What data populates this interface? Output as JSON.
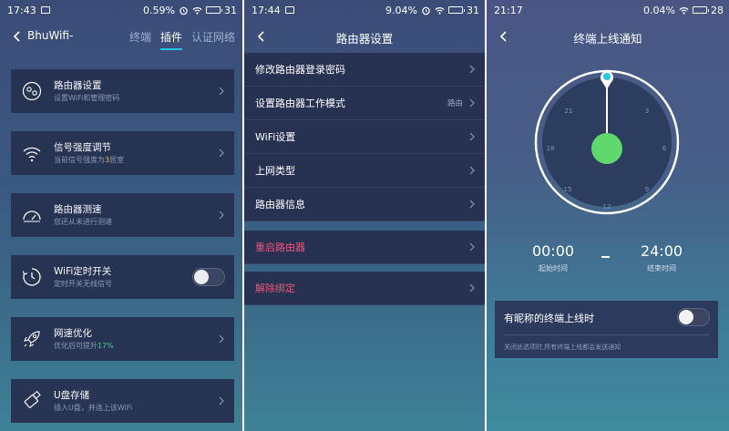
{
  "screen1": {
    "status": {
      "time": "17:43",
      "battery_pct": "0.59%",
      "battery": "31"
    },
    "app_title": "BhuWifi-",
    "tabs": [
      {
        "label": "终端",
        "active": false
      },
      {
        "label": "插件",
        "active": true
      },
      {
        "label": "认证网络",
        "active": false
      }
    ],
    "cards": [
      {
        "icon": "router-settings-icon",
        "title": "路由器设置",
        "sub": "设置WiFi和管理密码",
        "action": "chevron"
      },
      {
        "icon": "wifi-signal-icon",
        "title": "信号强度调节",
        "sub_pre": "当前信号强度为",
        "sub_hl": "3",
        "sub_post": "居室",
        "action": "chevron"
      },
      {
        "icon": "speedometer-icon",
        "title": "路由器测速",
        "sub": "您还从未进行测速",
        "action": "chevron"
      },
      {
        "icon": "clock-timer-icon",
        "title": "WiFi定时开关",
        "sub": "定时开关无线信号",
        "action": "toggle",
        "toggle_on": false
      },
      {
        "icon": "rocket-icon",
        "title": "网速优化",
        "sub_pre": "优化后可提升",
        "sub_hl": "17%",
        "sub_post": "",
        "action": "chevron"
      },
      {
        "icon": "usb-drive-icon",
        "title": "U盘存储",
        "sub": "插入U盘，并连上该WiFi",
        "action": "chevron"
      }
    ]
  },
  "screen2": {
    "status": {
      "time": "17:44",
      "battery_pct": "9.04%",
      "battery": "31"
    },
    "title": "路由器设置",
    "rows": [
      {
        "label": "修改路由器登录密码",
        "value": "",
        "danger": false
      },
      {
        "label": "设置路由器工作模式",
        "value": "路由",
        "danger": false
      },
      {
        "label": "WiFi设置",
        "value": "",
        "danger": false
      },
      {
        "label": "上网类型",
        "value": "",
        "danger": false
      },
      {
        "label": "路由器信息",
        "value": "",
        "danger": false
      },
      {
        "label": "重启路由器",
        "value": "",
        "danger": true
      },
      {
        "label": "解除绑定",
        "value": "",
        "danger": true
      }
    ]
  },
  "screen3": {
    "status": {
      "time": "21:17",
      "battery_pct": "0.04%",
      "battery": "28"
    },
    "title": "终端上线通知",
    "dial_numbers": [
      "21",
      "3",
      "18",
      "6",
      "15",
      "9",
      "12"
    ],
    "start_time": "00:00",
    "start_label": "起始时间",
    "separator": "—",
    "end_time": "24:00",
    "end_label": "结束时间",
    "notice_title": "有昵称的终端上线时",
    "notice_toggle_on": false,
    "notice_hint": "关闭此选项时,所有终端上线都会发送通知"
  },
  "colors": {
    "accent": "#21c8e6",
    "card": "#273252",
    "danger": "#e6587a",
    "highlight_yellow": "#f2c342",
    "highlight_green": "#3cd48c",
    "dial_center": "#5fd86e"
  }
}
